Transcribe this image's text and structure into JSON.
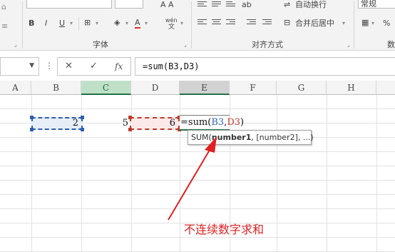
{
  "ribbon": {
    "clipboard_partial_icons": [
      "≡",
      "⌂"
    ],
    "font_top_row_partial": "A  A",
    "bold_label": "B",
    "italic_label": "I",
    "underline_label": "U",
    "font_group_label": "字体",
    "alignment_group_label": "对齐方式",
    "wrap_text_label": "自动换行",
    "merge_center_label": "合并后居中",
    "number_format_value": "常规",
    "number_group_label_partial": "数",
    "percent_label": "%",
    "wen_label": "wén"
  },
  "formula_bar": {
    "name_box_value": "",
    "cancel_icon": "✕",
    "enter_icon": "✓",
    "function_icon": "fx",
    "formula": "=sum(B3,D3)"
  },
  "columns": [
    "A",
    "B",
    "C",
    "D",
    "E",
    "F",
    "G",
    "H"
  ],
  "cells": {
    "B3": "2",
    "C3": "5",
    "D3": "6"
  },
  "edit": {
    "prefix": "=sum(",
    "ref1": "B3",
    "comma": ",",
    "ref2": "D3",
    "suffix": ")"
  },
  "tooltip": {
    "func": "SUM(",
    "arg1": "number1",
    "rest": ", [number2], ...)"
  },
  "annotation": "不连续数字求和",
  "colors": {
    "excel_green": "#217346",
    "ref_blue": "#2e64b8",
    "ref_red": "#c0392b",
    "annotation_red": "#e02020"
  }
}
